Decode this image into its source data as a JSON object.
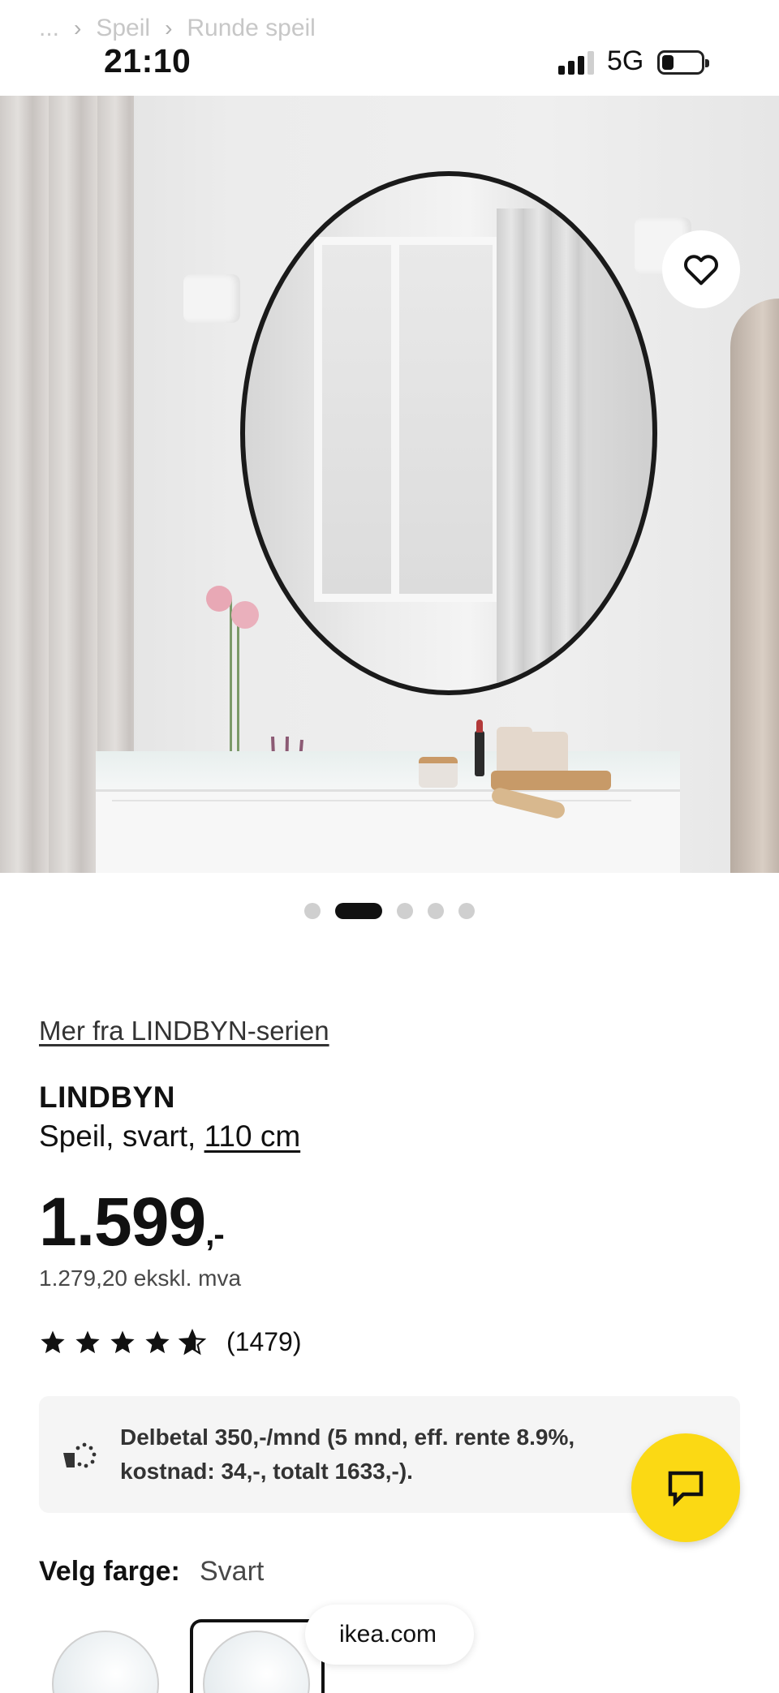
{
  "breadcrumb": {
    "items": [
      "...",
      "Speil",
      "Runde speil"
    ]
  },
  "status_bar": {
    "time": "21:10",
    "network": "5G",
    "icons": [
      "signal-icon",
      "battery-icon"
    ]
  },
  "gallery": {
    "image_count": 5,
    "active_index": 1,
    "favorite_icon": "heart-icon"
  },
  "product": {
    "series_link": "Mer fra LINDBYN-serien",
    "name": "LINDBYN",
    "description_prefix": "Speil, svart, ",
    "size": "110 cm",
    "price": "1.599",
    "price_suffix": ",-",
    "price_ex_vat": "1.279,20 ekskl. mva",
    "rating": 4.7,
    "rating_count": "(1479)"
  },
  "finance": {
    "icon": "installment-icon",
    "text": "Delbetal 350,-/mnd (5 mnd, eff. rente 8.9%, kostnad: 34,-, totalt 1633,-)."
  },
  "color": {
    "label": "Velg farge:",
    "value": "Svart"
  },
  "chat": {
    "icon": "chat-icon",
    "color": "#FBD914"
  },
  "browser": {
    "domain": "ikea.com"
  }
}
